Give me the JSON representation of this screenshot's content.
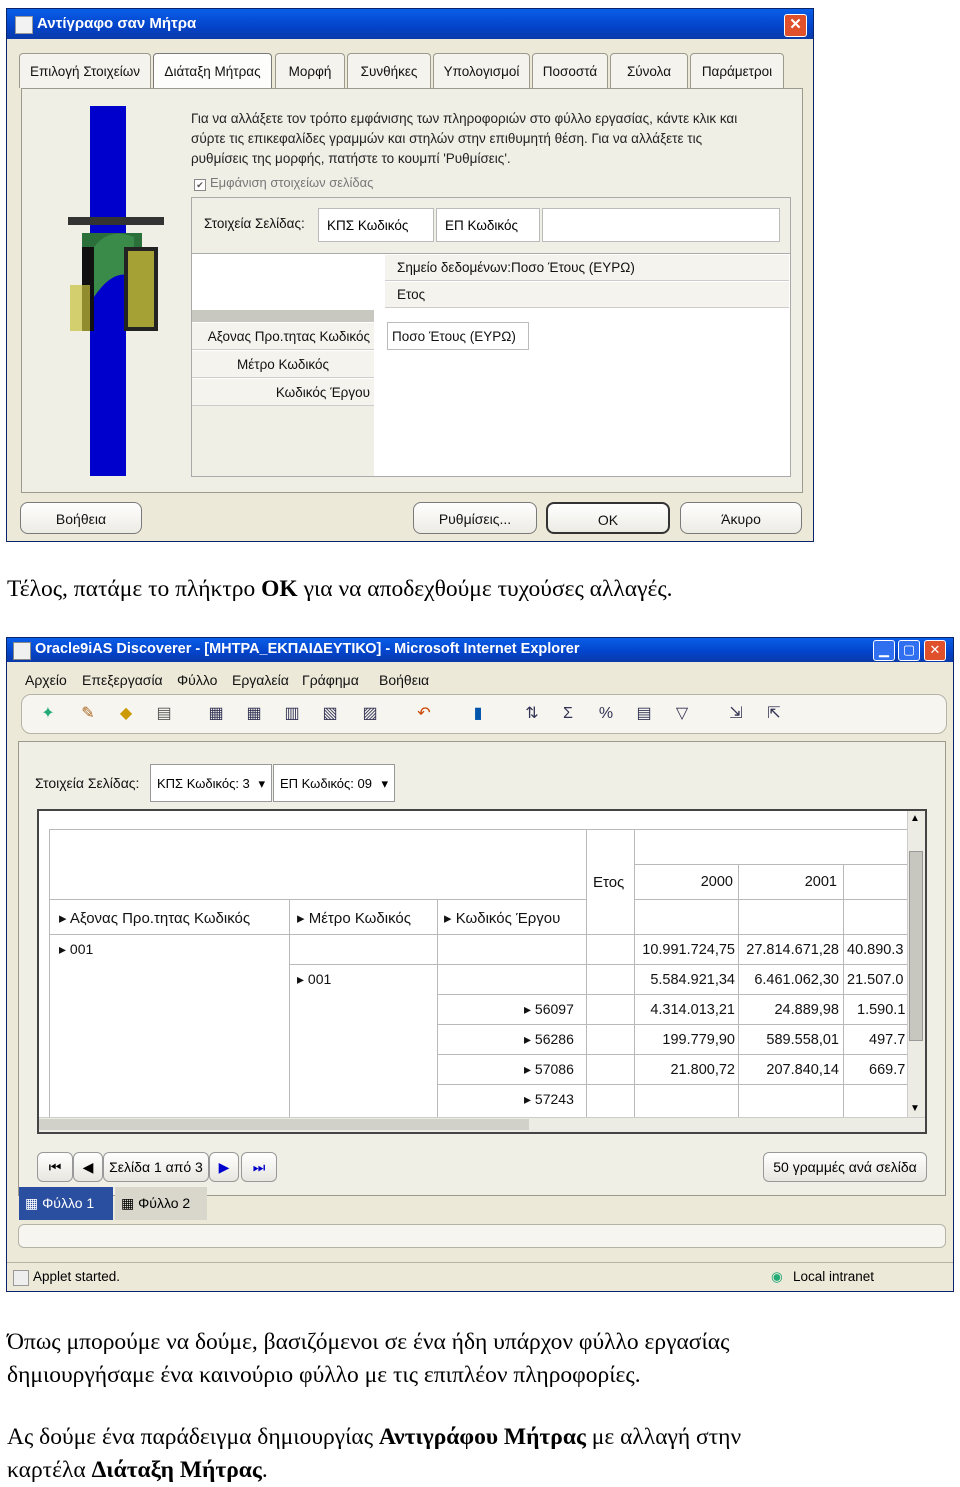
{
  "dialog": {
    "title": "Αντίγραφο σαν Μήτρα",
    "close_glyph": "✕",
    "tabs": [
      "Επιλογή Στοιχείων",
      "Διάταξη Μήτρας",
      "Μορφή",
      "Συνθήκες",
      "Υπολογισμοί",
      "Ποσοστά",
      "Σύνολα",
      "Παράμετροι"
    ],
    "active_tab": "Διάταξη Μήτρας",
    "help_lines": [
      "Για να αλλάξετε τον τρόπο εμφάνισης των πληροφοριών στο φύλλο εργασίας, κάντε κλικ και",
      "σύρτε τις επικεφαλίδες γραμμών και στηλών στην επιθυμητή θέση. Για να αλλάξετε τις",
      "ρυθμίσεις της μορφής, πατήστε το κουμπί 'Ρυθμίσεις'."
    ],
    "show_page_items_label": "Εμφάνιση στοιχείων σελίδας",
    "page_items_label": "Στοιχεία Σελίδας:",
    "page_items": [
      "ΚΠΣ Κωδικός",
      "ΕΠ Κωδικός"
    ],
    "column_items": [
      "Σημείο δεδομένων:Ποσο Έτους (ΕΥΡΩ)",
      "Ετος"
    ],
    "row_items": [
      "Αξονας Προ.τητας Κωδικός",
      "Μέτρο Κωδικός",
      "Κωδικός Έργου"
    ],
    "data_item": "Ποσο Έτους (ΕΥΡΩ)",
    "buttons": {
      "help": "Βοήθεια",
      "settings": "Ρυθμίσεις...",
      "ok": "ΟΚ",
      "cancel": "Άκυρο"
    }
  },
  "paragraph1": {
    "before": "Τέλος, πατάμε το πλήκτρο ",
    "bold": "OK",
    "after": " για να αποδεχθούμε τυχούσες αλλαγές."
  },
  "browser": {
    "title": "Oracle9iAS Discoverer - [ΜΗΤΡΑ_ΕΚΠΑΙΔΕΥΤΙΚΟ] - Microsoft Internet Explorer",
    "menu": [
      "Αρχείο",
      "Επεξεργασία",
      "Φύλλο",
      "Εργαλεία",
      "Γράφημα",
      "Βοήθεια"
    ],
    "toolbar_icons": [
      "new-icon",
      "open-icon",
      "save-icon",
      "print-icon",
      "table-icon",
      "crosstab-icon",
      "layout-icon",
      "edit-icon",
      "sheet-icon",
      "undo-icon",
      "graph-icon",
      "sort-icon",
      "sum-icon",
      "percent-icon",
      "format-icon",
      "filter-icon",
      "drill-icon",
      "export-icon"
    ],
    "page_items_label": "Στοιχεία Σελίδας:",
    "page_item_values": [
      "ΚΠΣ Κωδικός: 3",
      "ΕΠ Κωδικός: 09"
    ],
    "column_header": "Ετος",
    "years": [
      "2000",
      "2001"
    ],
    "row_headers": [
      "Αξονας Προ.τητας Κωδικός",
      "Μέτρο Κωδικός",
      "Κωδικός Έργου"
    ],
    "rows": [
      {
        "axis": "001",
        "measure": "",
        "project": "",
        "v2000": "10.991.724,75",
        "v2001": "27.814.671,28",
        "v2002": "40.890.3"
      },
      {
        "axis": "",
        "measure": "001",
        "project": "",
        "v2000": "5.584.921,34",
        "v2001": "6.461.062,30",
        "v2002": "21.507.0"
      },
      {
        "axis": "",
        "measure": "",
        "project": "56097",
        "v2000": "4.314.013,21",
        "v2001": "24.889,98",
        "v2002": "1.590.1"
      },
      {
        "axis": "",
        "measure": "",
        "project": "56286",
        "v2000": "199.779,90",
        "v2001": "589.558,01",
        "v2002": "497.7"
      },
      {
        "axis": "",
        "measure": "",
        "project": "57086",
        "v2000": "21.800,72",
        "v2001": "207.840,14",
        "v2002": "669.7"
      },
      {
        "axis": "",
        "measure": "",
        "project": "57243",
        "v2000": "",
        "v2001": "",
        "v2002": ""
      }
    ],
    "page_nav": "Σελίδα 1 από 3",
    "rows_per_page": "50 γραμμές ανά σελίδα",
    "sheet_tabs": [
      "Φύλλο 1",
      "Φύλλο 2"
    ],
    "status_left": "Applet started.",
    "status_right": "Local intranet"
  },
  "paragraph2": "Όπως μπορούμε να δούμε, βασιζόμενοι σε ένα ήδη υπάρχον φύλλο εργασίας",
  "paragraph2b": "δημιουργήσαμε ένα καινούριο φύλλο με τις επιπλέον πληροφορίες.",
  "paragraph3": {
    "before": "Ας δούμε ένα παράδειγμα δημιουργίας ",
    "bold1": "Αντιγράφου Μήτρας",
    "mid": " με αλλαγή στην",
    "line2_before": "καρτέλα ",
    "bold2": "Διάταξη Μήτρας",
    "after": "."
  }
}
